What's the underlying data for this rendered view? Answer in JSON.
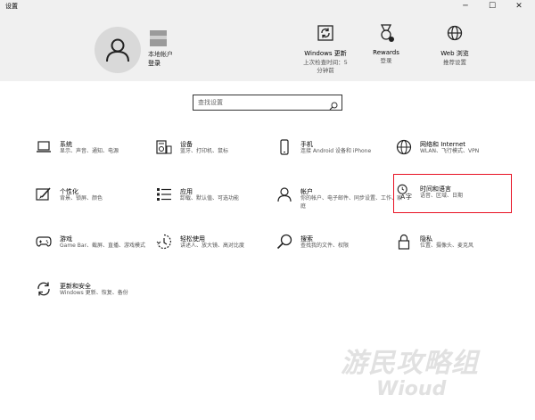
{
  "window": {
    "title": "设置",
    "minimize": "─",
    "maximize": "☐",
    "close": "✕"
  },
  "account": {
    "type": "本地帐户",
    "login": "登录"
  },
  "header_items": [
    {
      "label": "Windows 更新",
      "sub": "上次检查时间：5 分钟前",
      "icon": "sync-icon"
    },
    {
      "label": "Rewards",
      "sub": "登录",
      "icon": "rewards-medal-icon"
    },
    {
      "label": "Web 浏览",
      "sub": "推荐设置",
      "icon": "globe-icon"
    }
  ],
  "search": {
    "placeholder": "查找设置"
  },
  "categories": [
    {
      "name": "系统",
      "desc": "显示、声音、通知、电源",
      "icon": "laptop-icon"
    },
    {
      "name": "设备",
      "desc": "蓝牙、打印机、鼠标",
      "icon": "keyboard-speaker-icon"
    },
    {
      "name": "手机",
      "desc": "连接 Android 设备和 iPhone",
      "icon": "phone-icon"
    },
    {
      "name": "网络和 Internet",
      "desc": "WLAN、飞行模式、VPN",
      "icon": "network-globe-icon"
    },
    {
      "name": "个性化",
      "desc": "背景、锁屏、颜色",
      "icon": "paint-brush-icon"
    },
    {
      "name": "应用",
      "desc": "卸载、默认值、可选功能",
      "icon": "apps-list-icon"
    },
    {
      "name": "帐户",
      "desc": "你的帐户、电子邮件、同步设置、工作、家庭",
      "icon": "person-icon"
    },
    {
      "name": "时间和语言",
      "desc": "语音、区域、日期",
      "icon": "time-language-icon"
    },
    {
      "name": "游戏",
      "desc": "Game Bar、截屏、直播、游戏模式",
      "icon": "gamepad-icon"
    },
    {
      "name": "轻松使用",
      "desc": "讲述人、放大镜、高对比度",
      "icon": "ease-of-access-icon"
    },
    {
      "name": "搜索",
      "desc": "查找我的文件、权限",
      "icon": "search-icon"
    },
    {
      "name": "隐私",
      "desc": "位置、摄像头、麦克风",
      "icon": "lock-icon"
    },
    {
      "name": "更新和安全",
      "desc": "Windows 更新、恢复、备份",
      "icon": "update-sync-icon"
    }
  ],
  "watermark": {
    "cn": "游民攻略组",
    "en": "Wioud"
  },
  "colors": {
    "header_bg": "#f0f0f0",
    "highlight": "#e81123"
  }
}
